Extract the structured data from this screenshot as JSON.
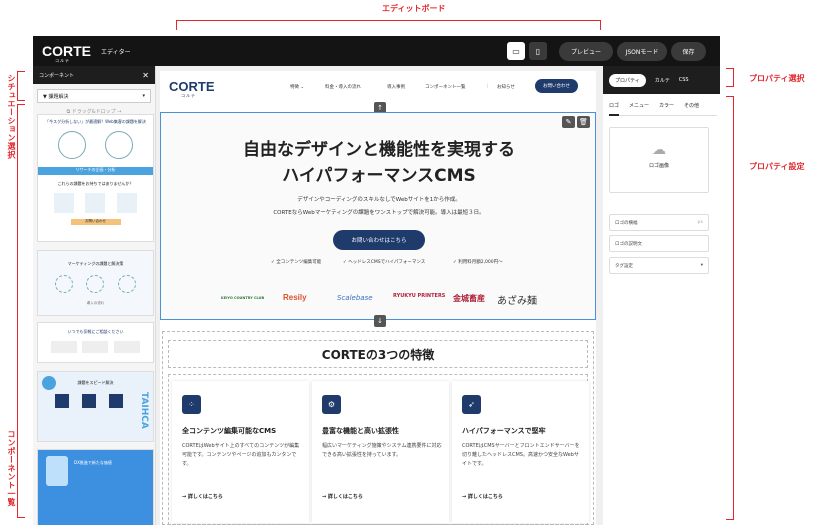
{
  "annotations": {
    "edit_board": "エディットボード",
    "situation_select": "シチュエーション選択",
    "component_list": "コンポーネント一覧",
    "property_select": "プロパティ選択",
    "property_settings": "プロパティ設定"
  },
  "topbar": {
    "logo": "CORTE",
    "logo_sub": "コルテ",
    "editor_label": "エディター",
    "buttons": [
      "プレビュー",
      "JSONモード",
      "保存"
    ]
  },
  "left_panel": {
    "title": "コンポーネント",
    "filter_label": "課題解決",
    "drag_drop": "ドラッグ&ドロップ"
  },
  "thumbnails": [
    {
      "heading": "「今スグ分析しない」が最適解？Web集客の課題を解決",
      "mid": "リサーチの企画・分析",
      "label": "Webマーケの課題"
    },
    {
      "heading": "これらの課題をお持ちではありませんか？",
      "mid": "お問い合わせ"
    },
    {
      "heading": "マーケティングの課題と解決策",
      "mid": "導入の流れ"
    },
    {
      "heading": "いつでも気軽にご相談ください"
    },
    {
      "heading": "課題をスピード解決",
      "mid": "TAIHCA"
    },
    {
      "heading": "DX推進で新たな価値"
    }
  ],
  "nav": {
    "logo": "CORTE",
    "logo_sub": "コルテ",
    "items": [
      "特徴 ⌄",
      "料金・導入の流れ",
      "導入事例",
      "コンポーネント一覧",
      "お知らせ"
    ],
    "cta": "お問い合わせ"
  },
  "hero": {
    "title1": "自由なデザインと機能性を実現する",
    "title2": "ハイパフォーマンスCMS",
    "sub1": "デザインやコーディングのスキルなしでWebサイトを1から作成。",
    "sub2": "CORTEならWebマーケティングの課題をワンストップで解決可能。導入は最短３日。",
    "button": "お問い合わせはこちら",
    "checks": [
      "✓ 全コンテンツ編集可能",
      "✓ ヘッドレスCMSでハイパフォーマンス",
      "✓ 利用料月額2,000円〜"
    ],
    "brands": [
      "KEIYO COUNTRY CLUB",
      "Resily",
      "Scalebase",
      "RYUKYU PRINTERS",
      "金城畜産",
      "あざみ麺"
    ]
  },
  "features": {
    "heading": "CORTEの3つの特徴",
    "cards": [
      {
        "icon": "⁘",
        "title": "全コンテンツ編集可能なCMS",
        "desc": "CORTEはWebサイト上のすべてのコンテンツが編集可能です。コンテンツやページの追加もカンタンです。",
        "link": "→ 詳しくはこちら"
      },
      {
        "icon": "⚙",
        "title": "豊富な機能と高い拡張性",
        "desc": "幅広いマーケティング施策やシステム連携要件に対応できる高い拡張性を持っています。",
        "link": "→ 詳しくはこちら"
      },
      {
        "icon": "➶",
        "title": "ハイパフォーマンスで堅牢",
        "desc": "CORTEはCMSサーバーとフロントエンドサーバーを切り離したヘッドレスCMS。高速かつ安全なWebサイトです。",
        "link": "→ 詳しくはこちら"
      }
    ]
  },
  "right_panel": {
    "tabs": [
      "プロパティ",
      "カルテ",
      "CSS"
    ],
    "subtabs": [
      "ロゴ",
      "メニュー",
      "カラー",
      "その他"
    ],
    "image_label": "ロゴ画像",
    "fields": [
      {
        "label": "ロゴの横幅",
        "suffix": "px"
      },
      {
        "label": "ロゴの説明文",
        "suffix": ""
      },
      {
        "label": "タグ設定",
        "suffix": "▾"
      }
    ]
  }
}
